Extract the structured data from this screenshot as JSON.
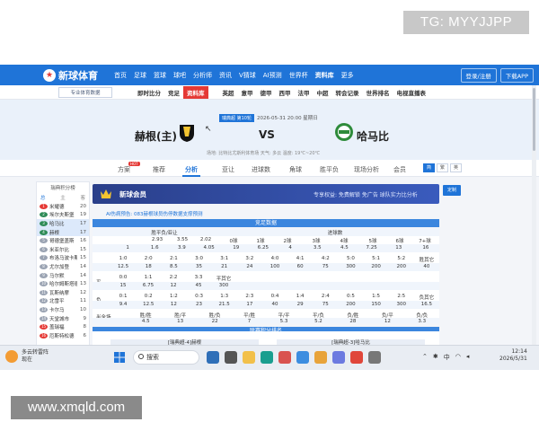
{
  "watermarks": {
    "top": "TG: MYYJJPP",
    "bottom": "www.xmqld.com"
  },
  "topnav": {
    "logo": "新球体育",
    "items": [
      "首页",
      "足球",
      "篮球",
      "球吧",
      "分析师",
      "资讯",
      "V猜球",
      "AI预测",
      "世界杯",
      "资料库",
      "更多"
    ],
    "login": "登录/注册",
    "download": "下载APP"
  },
  "subnav": {
    "pro_button": "专业体育数据",
    "tabs": [
      "即时比分",
      "竞足",
      "资料库"
    ],
    "active_tab": "资料库",
    "leagues": [
      "英超",
      "意甲",
      "德甲",
      "西甲",
      "法甲",
      "中超",
      "转会记录",
      "世界排名",
      "电视直播表"
    ]
  },
  "match": {
    "tag": "瑞典超 第10轮",
    "time": "2026-05-31 20:00 星期日",
    "home": "赫根(主)",
    "vs": "VS",
    "away": "哈马比",
    "info": "场地: 比特比尤斯利体育场    天气: 多云    温度: 19℃~20℃"
  },
  "tabs": {
    "items": [
      "方案",
      "推荐",
      "分析",
      "亚让",
      "进球数",
      "角球",
      "胜平负",
      "现场分析",
      "会员"
    ],
    "active": "分析",
    "hot_badge": "HOT",
    "view": [
      "简",
      "繁",
      "英"
    ]
  },
  "left_panel": {
    "title": "瑞典积分榜",
    "header": [
      "总",
      "主",
      "客"
    ],
    "rows": [
      {
        "rank": "1",
        "name": "米耀德",
        "pts": "20",
        "color": "#e53935"
      },
      {
        "rank": "2",
        "name": "埃尔夫斯堡",
        "pts": "19",
        "color": "#2e8b57"
      },
      {
        "rank": "3",
        "name": "哈马比",
        "pts": "17",
        "color": "#2e8b57"
      },
      {
        "rank": "4",
        "name": "赫根",
        "pts": "17",
        "color": "#2e8b57"
      },
      {
        "rank": "5",
        "name": "哥德堡盖斯",
        "pts": "16",
        "color": "#9aa3b2"
      },
      {
        "rank": "6",
        "name": "米亚尔比",
        "pts": "15",
        "color": "#9aa3b2"
      },
      {
        "rank": "7",
        "name": "布洛马波卡斯",
        "pts": "15",
        "color": "#9aa3b2"
      },
      {
        "rank": "8",
        "name": "尤尔加登",
        "pts": "14",
        "color": "#9aa3b2"
      },
      {
        "rank": "9",
        "name": "马尔默",
        "pts": "14",
        "color": "#9aa3b2"
      },
      {
        "rank": "10",
        "name": "哈尔姆斯塔德",
        "pts": "13",
        "color": "#9aa3b2"
      },
      {
        "rank": "11",
        "name": "瓦斯纳摩",
        "pts": "12",
        "color": "#9aa3b2"
      },
      {
        "rank": "12",
        "name": "北雪平",
        "pts": "11",
        "color": "#9aa3b2"
      },
      {
        "rank": "13",
        "name": "卡尔马",
        "pts": "10",
        "color": "#9aa3b2"
      },
      {
        "rank": "14",
        "name": "天堂城市",
        "pts": "9",
        "color": "#9aa3b2"
      },
      {
        "rank": "15",
        "name": "盖瑞福",
        "pts": "8",
        "color": "#e53935"
      },
      {
        "rank": "16",
        "name": "厄斯特松德",
        "pts": "6",
        "color": "#e53935"
      }
    ]
  },
  "vip": {
    "title": "新球会员",
    "desc": "专享权益: 免费解锁 免广告 球队实力比分析",
    "subscribe": "定制"
  },
  "ai_line": "AI伤病预告: 083赫根球员伤停数据支撑预测",
  "sections": {
    "odds": "竞足数据",
    "standings": "联赛积分排名"
  },
  "stats": {
    "col_a": "胜平负/亚让",
    "col_b": "进球数",
    "label_all": "全场",
    "row0": [
      "2.93",
      "3.55",
      "2.02",
      "0球",
      "1球",
      "2球",
      "3球",
      "4球",
      "5球",
      "6球",
      "7+球"
    ],
    "row1": [
      "1",
      "1.6",
      "3.9",
      "4.05",
      "19",
      "6.25",
      "4",
      "3.5",
      "4.5",
      "7.25",
      "13",
      "16"
    ],
    "lbl_sheng": "胜",
    "row2": [
      "1:0",
      "2:0",
      "2:1",
      "3:0",
      "3:1",
      "3:2",
      "4:0",
      "4:1",
      "4:2",
      "5:0",
      "5:1",
      "5:2",
      "胜其它"
    ],
    "row3": [
      "12.5",
      "18",
      "8.5",
      "35",
      "21",
      "24",
      "100",
      "60",
      "75",
      "300",
      "200",
      "200",
      "40"
    ],
    "lbl_ping": "平",
    "row4": [
      "0:0",
      "1:1",
      "2:2",
      "3:3",
      "平其它"
    ],
    "row5": [
      "15",
      "6.75",
      "12",
      "45",
      "300"
    ],
    "lbl_fu": "负",
    "row6": [
      "0:1",
      "0:2",
      "1:2",
      "0:3",
      "1:3",
      "2:3",
      "0:4",
      "1:4",
      "2:4",
      "0:5",
      "1:5",
      "2:5",
      "负其它"
    ],
    "row7": [
      "9.4",
      "12.5",
      "12",
      "23",
      "21.5",
      "17",
      "40",
      "29",
      "75",
      "200",
      "150",
      "300",
      "16.5"
    ],
    "label_half": "半全场",
    "row8": [
      "胜/胜",
      "胜/平",
      "胜/负",
      "平/胜",
      "平/平",
      "平/负",
      "负/胜",
      "负/平",
      "负/负"
    ],
    "row9": [
      "4.5",
      "13",
      "22",
      "7",
      "5.3",
      "5.2",
      "28",
      "12",
      "3.3"
    ]
  },
  "bottom": {
    "left": "[瑞典超-4]赫根",
    "right": "[瑞典超-3]哈马比"
  },
  "taskbar": {
    "weather_title": "多云转雷阵",
    "weather_sub": "现在",
    "search": "搜索",
    "time": "12:14",
    "date": "2026/5/31",
    "lang": "中"
  }
}
